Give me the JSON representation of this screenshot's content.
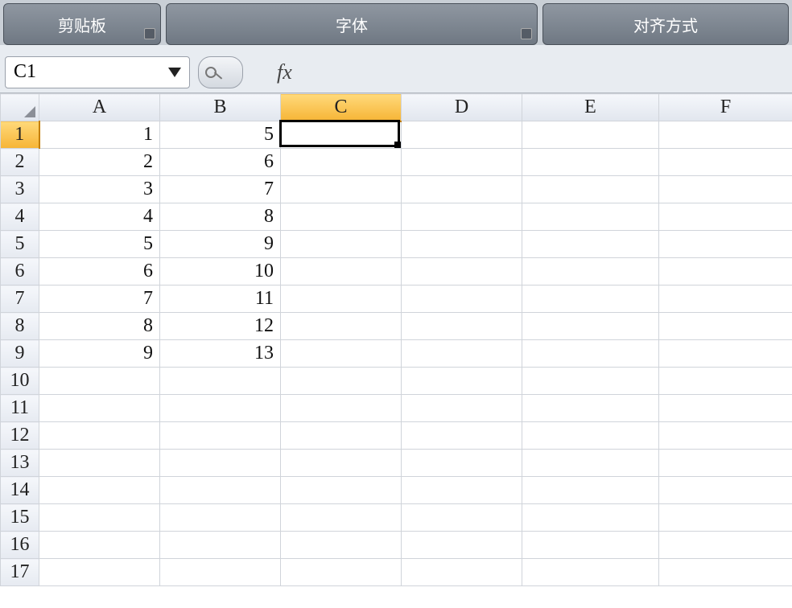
{
  "ribbon": {
    "clipboard_label": "剪贴板",
    "font_label": "字体",
    "alignment_label": "对齐方式"
  },
  "namebox": {
    "value": "C1"
  },
  "fx": {
    "label": "fx"
  },
  "formula_bar": {
    "value": ""
  },
  "columns": [
    "A",
    "B",
    "C",
    "D",
    "E",
    "F"
  ],
  "selected_column": "C",
  "selected_row": 1,
  "active_cell": "C1",
  "row_count": 17,
  "cells": {
    "A": {
      "1": "1",
      "2": "2",
      "3": "3",
      "4": "4",
      "5": "5",
      "6": "6",
      "7": "7",
      "8": "8",
      "9": "9"
    },
    "B": {
      "1": "5",
      "2": "6",
      "3": "7",
      "4": "8",
      "5": "9",
      "6": "10",
      "7": "11",
      "8": "12",
      "9": "13"
    }
  },
  "colors": {
    "header_sel": "#f6b436",
    "grid_line": "#d0d4da",
    "arrow": "#ff1e1e"
  }
}
